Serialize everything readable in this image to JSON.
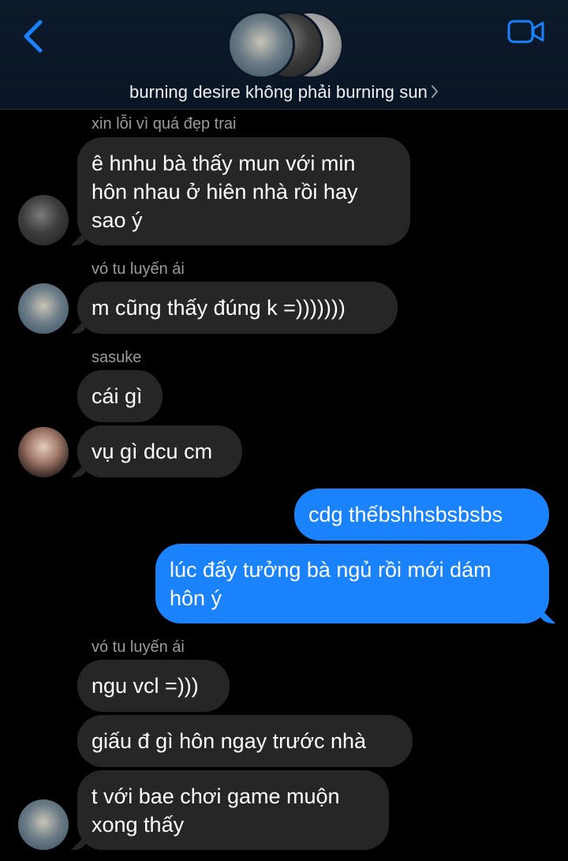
{
  "header": {
    "back_icon": "chevron-left-icon",
    "video_icon": "video-camera-icon",
    "group_name": "burning desire không phải burning sun",
    "accent_color": "#1a82fb"
  },
  "messages": [
    {
      "sender": "xin lỗi vì quá đẹp trai",
      "bubbles": [
        "ê hnhu bà thấy mun với min\nhôn nhau ở hiên nhà rồi hay\nsao ý"
      ]
    },
    {
      "sender": "vó tu luyến ái",
      "bubbles": [
        "m cũng thấy đúng k =)))))))"
      ]
    },
    {
      "sender": "sasuke",
      "bubbles": [
        "cái gì",
        "vụ gì dcu cm"
      ]
    },
    {
      "sender": "",
      "outgoing": true,
      "bubbles": [
        "cdg thếbshhsbsbsbs",
        "lúc đấy tưởng bà ngủ rồi mới dám\nhôn ý"
      ]
    },
    {
      "sender": "vó tu luyến ái",
      "bubbles": [
        "ngu vcl =)))",
        "giấu đ gì hôn ngay trước nhà",
        "t với bae chơi game muộn\nxong thấy"
      ]
    }
  ]
}
